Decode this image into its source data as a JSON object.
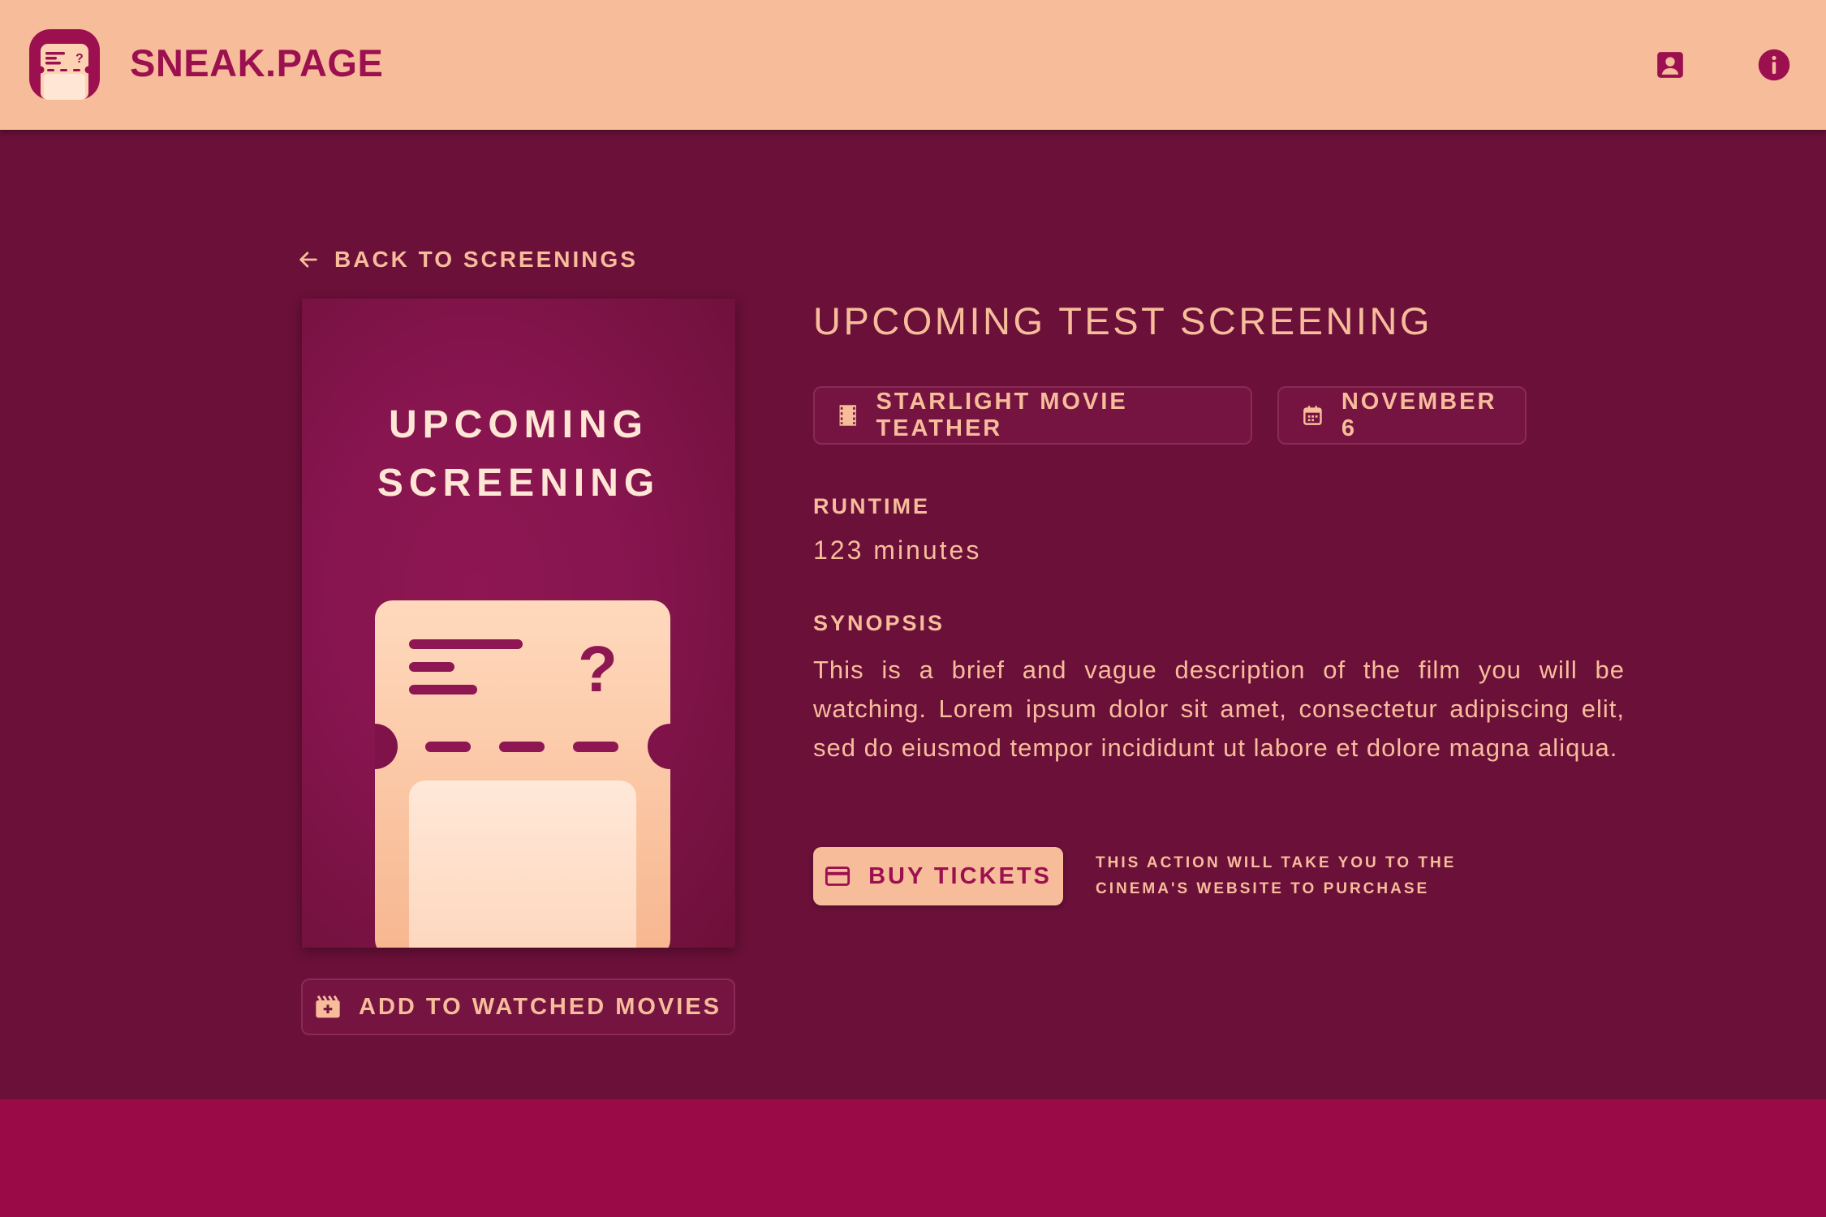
{
  "header": {
    "brand": "SNEAK.PAGE",
    "icons": [
      "ticket-logo-icon",
      "account-icon",
      "info-icon"
    ]
  },
  "nav": {
    "back_label": "BACK TO SCREENINGS"
  },
  "poster": {
    "title_line1": "UPCOMING",
    "title_line2": "SCREENING"
  },
  "actions": {
    "watched_label": "ADD TO WATCHED MOVIES",
    "buy_label": "BUY TICKETS",
    "buy_note": "THIS ACTION WILL TAKE YOU TO THE CINEMA'S WEBSITE TO PURCHASE"
  },
  "screening": {
    "title": "UPCOMING TEST SCREENING",
    "cinema": "STARLIGHT MOVIE TEATHER",
    "date": "NOVEMBER 6",
    "runtime_label": "RUNTIME",
    "runtime_value": "123 minutes",
    "synopsis_label": "SYNOPSIS",
    "synopsis": "This is a brief and vague description of the film you will be watching. Lorem ipsum dolor sit amet, consectetur adipiscing elit, sed do eiusmod tempor incididunt ut labore et dolore magna aliqua."
  },
  "colors": {
    "background": "#6b1039",
    "header": "#f7bd9b",
    "accent": "#9c1050",
    "footer": "#9a0a47",
    "text": "#f7bd9b"
  }
}
